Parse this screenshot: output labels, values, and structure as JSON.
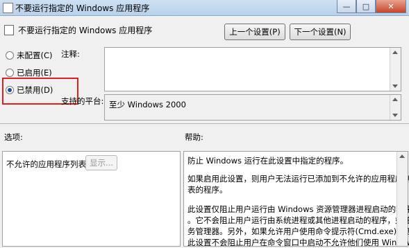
{
  "window": {
    "title": "不要运行指定的 Windows 应用程序"
  },
  "header": {
    "title": "不要运行指定的 Windows 应用程序",
    "prev_button": "上一个设置(P)",
    "next_button": "下一个设置(N)"
  },
  "state": {
    "options": [
      {
        "label": "未配置(C)",
        "checked": false
      },
      {
        "label": "已启用(E)",
        "checked": false
      },
      {
        "label": "已禁用(D)",
        "checked": true
      }
    ]
  },
  "comment": {
    "label": "注释:",
    "value": ""
  },
  "supported": {
    "label": "支持的平台:",
    "value": "至少 Windows 2000"
  },
  "options_section": {
    "label": "选项:",
    "list_label": "不允许的应用程序列表",
    "show_button": "显示..."
  },
  "help_section": {
    "label": "帮助:",
    "lines": [
      "防止 Windows 运行在此设置中指定的程序。",
      "",
      "如果启用此设置，则用户无法运行已添加到不允许的应用程序列",
      "表的程序。",
      "",
      "此设置仅阻止用户运行由 Windows 资源管理器进程启动的程序",
      "。它不会阻止用户运行由系统进程或其他进程启动的程序，如任",
      "务管理器。另外，如果允许用户使用命令提示符(Cmd.exe)，则",
      "此设置不会阻止用户在命令窗口中启动不允许他们使用 Windows"
    ]
  }
}
